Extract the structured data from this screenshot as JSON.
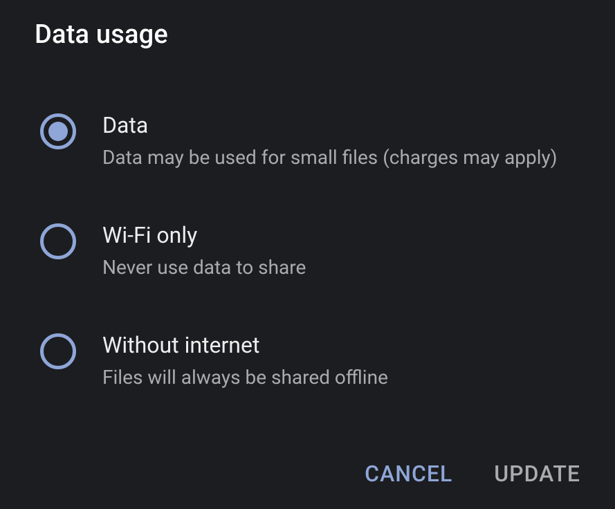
{
  "dialog": {
    "title": "Data usage",
    "selectedIndex": 0,
    "options": [
      {
        "title": "Data",
        "description": "Data may be used for small files (charges may apply)"
      },
      {
        "title": "Wi-Fi only",
        "description": "Never use data to share"
      },
      {
        "title": "Without internet",
        "description": "Files will always be shared offline"
      }
    ],
    "actions": {
      "cancel": "CANCEL",
      "update": "UPDATE"
    }
  }
}
